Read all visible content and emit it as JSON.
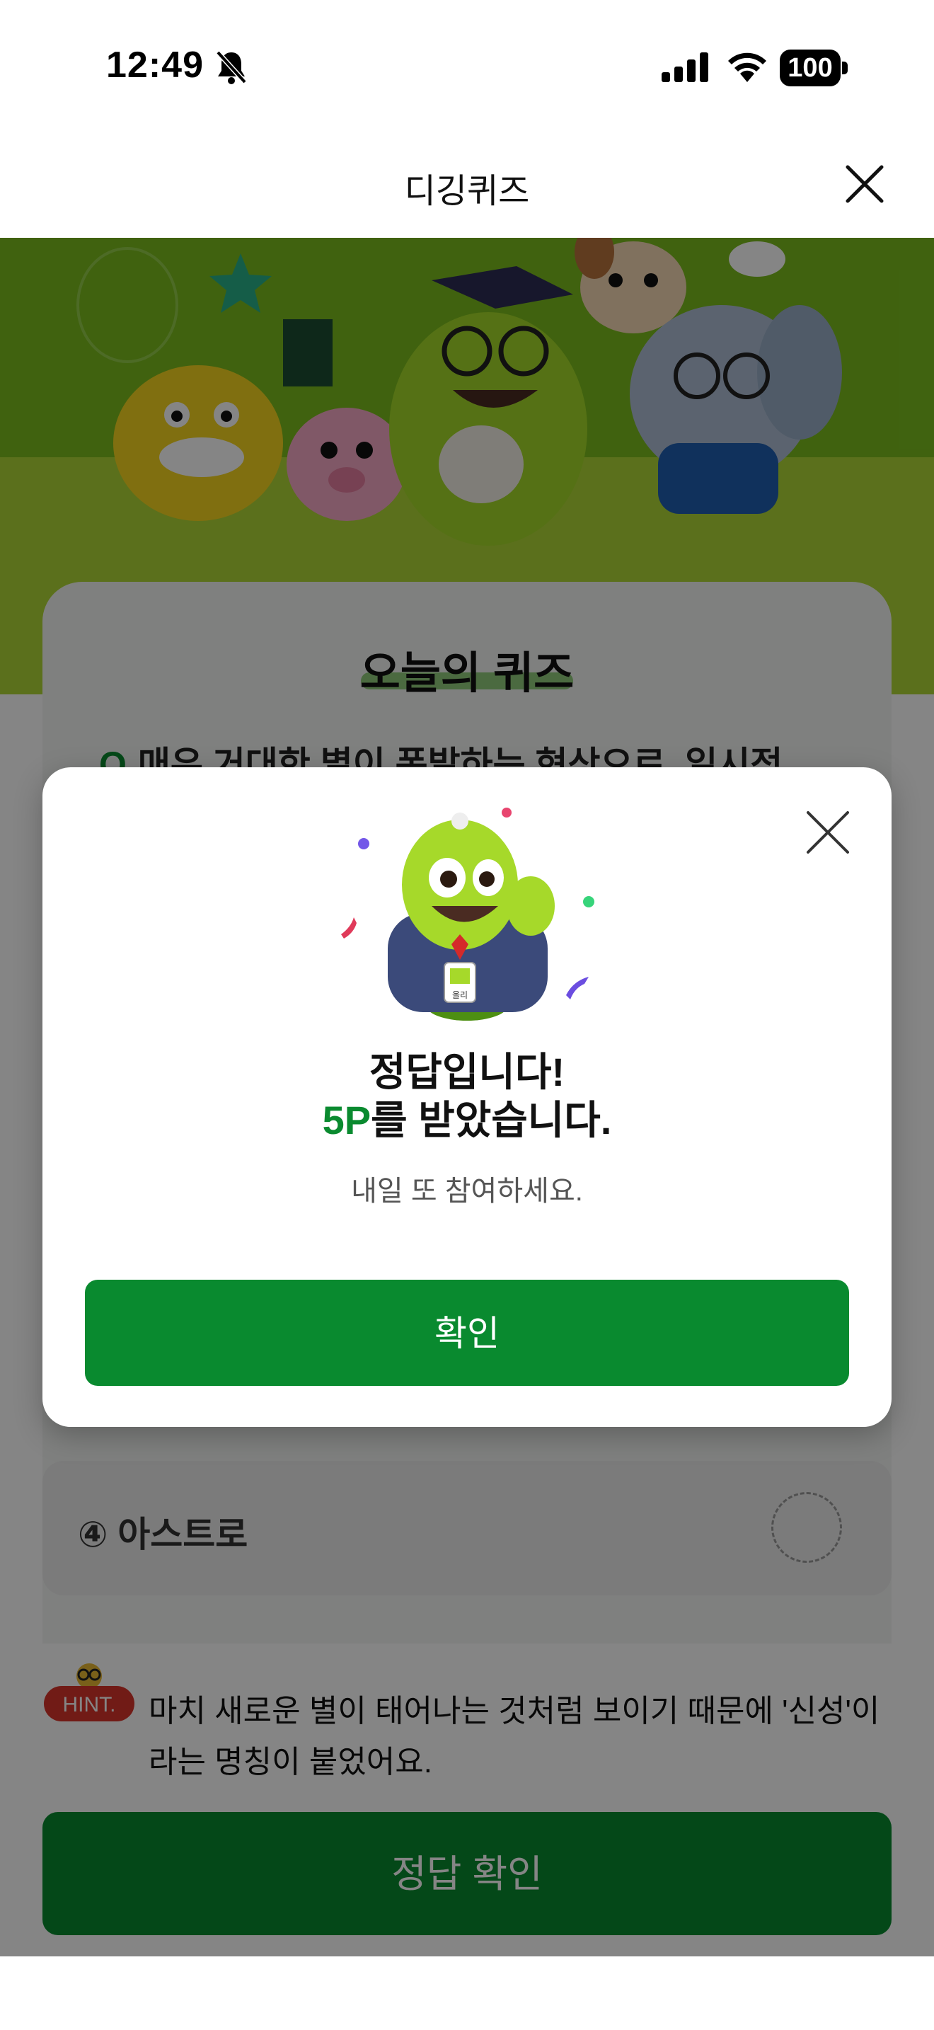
{
  "status_bar": {
    "time": "12:49",
    "battery": "100",
    "icons": [
      "bell-slash-icon",
      "signal-icon",
      "wifi-icon",
      "battery-icon"
    ]
  },
  "header": {
    "title": "디깅퀴즈",
    "close_icon": "close-icon"
  },
  "quiz": {
    "card_title": "오늘의 퀴즈",
    "question_prefix": "Q",
    "question": "매우 거대한 별이 폭발하는 현상으로, 일시적",
    "option_4": "④ 아스트로",
    "hint_badge": "HINT.",
    "hint": "마치 새로운 별이 태어나는 것처럼 보이기 때문에 '신성'이라는 명칭이 붙었어요.",
    "answer_button": "정답 확인"
  },
  "modal": {
    "title": "정답입니다!",
    "points": "5P",
    "points_suffix": "를 받았습니다.",
    "subtitle": "내일 또 참여하세요.",
    "confirm_button": "확인",
    "badge_text": "올리",
    "close_icon": "close-icon"
  },
  "colors": {
    "brand_green": "#098a2f",
    "points_green": "#0a8a2f",
    "banner_green": "#8ccb28",
    "hint_red": "#d9342b"
  }
}
